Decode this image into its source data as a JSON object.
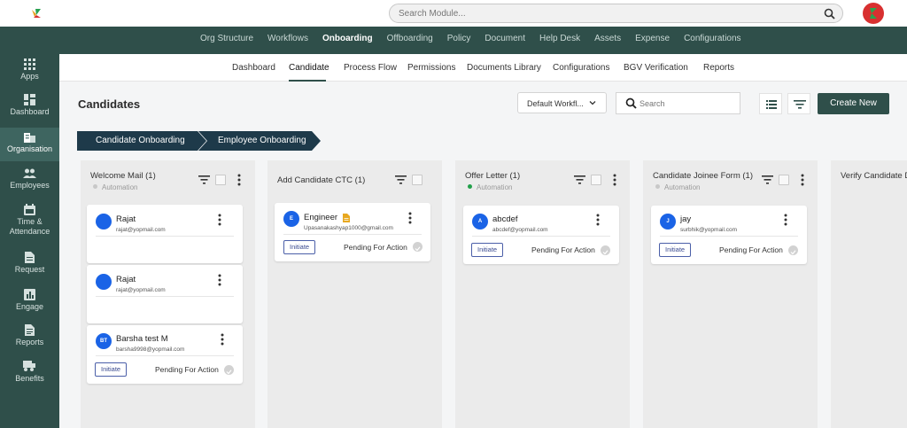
{
  "topbar": {
    "search_placeholder": "Search Module..."
  },
  "main_nav": [
    {
      "label": "Org Structure",
      "active": false
    },
    {
      "label": "Workflows",
      "active": false
    },
    {
      "label": "Onboarding",
      "active": true
    },
    {
      "label": "Offboarding",
      "active": false
    },
    {
      "label": "Policy",
      "active": false
    },
    {
      "label": "Document",
      "active": false
    },
    {
      "label": "Help Desk",
      "active": false
    },
    {
      "label": "Assets",
      "active": false
    },
    {
      "label": "Expense",
      "active": false
    },
    {
      "label": "Configurations",
      "active": false
    }
  ],
  "sidebar": [
    {
      "label": "Apps",
      "icon": "grid-icon"
    },
    {
      "label": "Dashboard",
      "icon": "dashboard-icon"
    },
    {
      "label": "Organisation",
      "icon": "building-icon",
      "active": true
    },
    {
      "label": "Employees",
      "icon": "people-icon"
    },
    {
      "label": "Time & Attendance",
      "icon": "calendar-icon"
    },
    {
      "label": "Request",
      "icon": "document-icon"
    },
    {
      "label": "Engage",
      "icon": "chart-icon"
    },
    {
      "label": "Reports",
      "icon": "report-icon"
    },
    {
      "label": "Benefits",
      "icon": "benefits-icon"
    }
  ],
  "sub_nav": [
    {
      "label": "Dashboard"
    },
    {
      "label": "Candidate",
      "active": true
    },
    {
      "label": "Process Flow"
    },
    {
      "label": "Permissions"
    },
    {
      "label": "Documents Library"
    },
    {
      "label": "Configurations"
    },
    {
      "label": "BGV Verification"
    },
    {
      "label": "Reports"
    }
  ],
  "page": {
    "title": "Candidates",
    "workflow_select": "Default Workfl...",
    "search_placeholder": "Search",
    "create_button": "Create New"
  },
  "stage_tabs": [
    {
      "label": "Candidate Onboarding"
    },
    {
      "label": "Employee Onboarding"
    }
  ],
  "columns": [
    {
      "title": "Welcome Mail (1)",
      "subtitle": "Automation",
      "status_color": "#c8c8c8",
      "cards": [
        {
          "initials": "",
          "name": "Rajat",
          "email": "rajat@yopmail.com"
        },
        {
          "initials": "",
          "name": "Rajat",
          "email": "rajat@yopmail.com"
        },
        {
          "initials": "BT",
          "name": "Barsha test M",
          "email": "barsha9998@yopmail.com",
          "action": "Initiate",
          "status": "Pending For Action"
        }
      ]
    },
    {
      "title": "Add Candidate CTC (1)",
      "subtitle": "",
      "cards": [
        {
          "initials": "E",
          "name": "Engineer",
          "email": "Upasanakashyap1000@gmail.com",
          "action": "Initiate",
          "status": "Pending For Action"
        }
      ]
    },
    {
      "title": "Offer Letter (1)",
      "subtitle": "Automation",
      "status_color": "#22a04a",
      "cards": [
        {
          "initials": "A",
          "name": "abcdef",
          "email": "abcdef@yopmail.com",
          "action": "Initiate",
          "status": "Pending For Action"
        }
      ]
    },
    {
      "title": "Candidate Joinee Form (1)",
      "subtitle": "Automation",
      "status_color": "#c8c8c8",
      "cards": [
        {
          "initials": "J",
          "name": "jay",
          "email": "surbhik@yopmail.com",
          "action": "Initiate",
          "status": "Pending For Action"
        }
      ]
    },
    {
      "title": "Verify Candidate D",
      "subtitle": "",
      "cards": []
    }
  ],
  "colors": {
    "brand_dark": "#2f4f4a",
    "avatar_blue": "#1a63e6",
    "button_outline": "#4b5fa8"
  }
}
